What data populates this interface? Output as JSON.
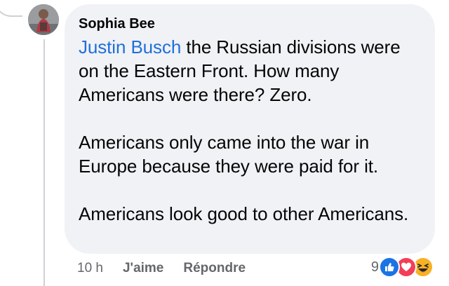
{
  "comment": {
    "author": "Sophia Bee",
    "mention": "Justin Busch",
    "paragraphs": [
      " the Russian divisions were on the Eastern Front. How many Americans were there? Zero.",
      "Americans only came into the war in Europe because they were paid for it.",
      "Americans look good to other Americans."
    ]
  },
  "actions": {
    "time": "10 h",
    "like_label": "J'aime",
    "reply_label": "Répondre"
  },
  "reactions": {
    "count": "9",
    "types": [
      "like-icon",
      "love-icon",
      "haha-icon"
    ],
    "colors": {
      "like": "#1b74e4",
      "love": "#f33e58",
      "haha": "#f7b125"
    }
  },
  "colors": {
    "bubble_bg": "#f0f2f5",
    "mention": "#216fdb",
    "text": "#050505",
    "meta": "#65676b"
  }
}
